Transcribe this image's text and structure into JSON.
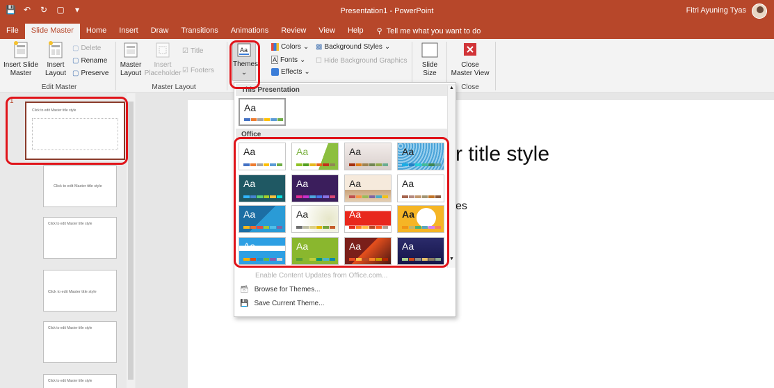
{
  "app": {
    "document_title": "Presentation1  -  PowerPoint",
    "user_name": "Fitri Ayuning Tyas"
  },
  "tabs": [
    "File",
    "Slide Master",
    "Home",
    "Insert",
    "Draw",
    "Transitions",
    "Animations",
    "Review",
    "View",
    "Help"
  ],
  "active_tab": "Slide Master",
  "tell_me": "Tell me what you want to do",
  "ribbon": {
    "insert_slide_master": [
      "Insert Slide",
      "Master"
    ],
    "insert_layout": [
      "Insert",
      "Layout"
    ],
    "delete": "Delete",
    "rename": "Rename",
    "preserve": "Preserve",
    "group_edit_master": "Edit Master",
    "master_layout": [
      "Master",
      "Layout"
    ],
    "insert_placeholder": [
      "Insert",
      "Placeholder"
    ],
    "title_check": "Title",
    "footers_check": "Footers",
    "group_master_layout": "Master Layout",
    "themes": "Themes",
    "colors": "Colors",
    "fonts": "Fonts",
    "effects": "Effects",
    "background_styles": "Background Styles",
    "hide_background": "Hide Background Graphics",
    "slide_size": [
      "Slide",
      "Size"
    ],
    "close_master": [
      "Close",
      "Master View"
    ],
    "group_close": "Close"
  },
  "dropdown": {
    "section_this": "This Presentation",
    "section_office": "Office",
    "tile_label": "Aa",
    "enable_updates": "Enable Content Updates from Office.com...",
    "browse_themes": "Browse for Themes...",
    "save_theme": "Save Current Theme..."
  },
  "thumbnails": {
    "master_title": "Click to edit Master title style",
    "layout_title": "Click to edit Master title style",
    "slide_number": "1"
  },
  "slide": {
    "title_fragment": "r title style",
    "body_fragment": "es"
  },
  "colors": {
    "accent": "#b7472a",
    "highlight": "#e0141a"
  }
}
